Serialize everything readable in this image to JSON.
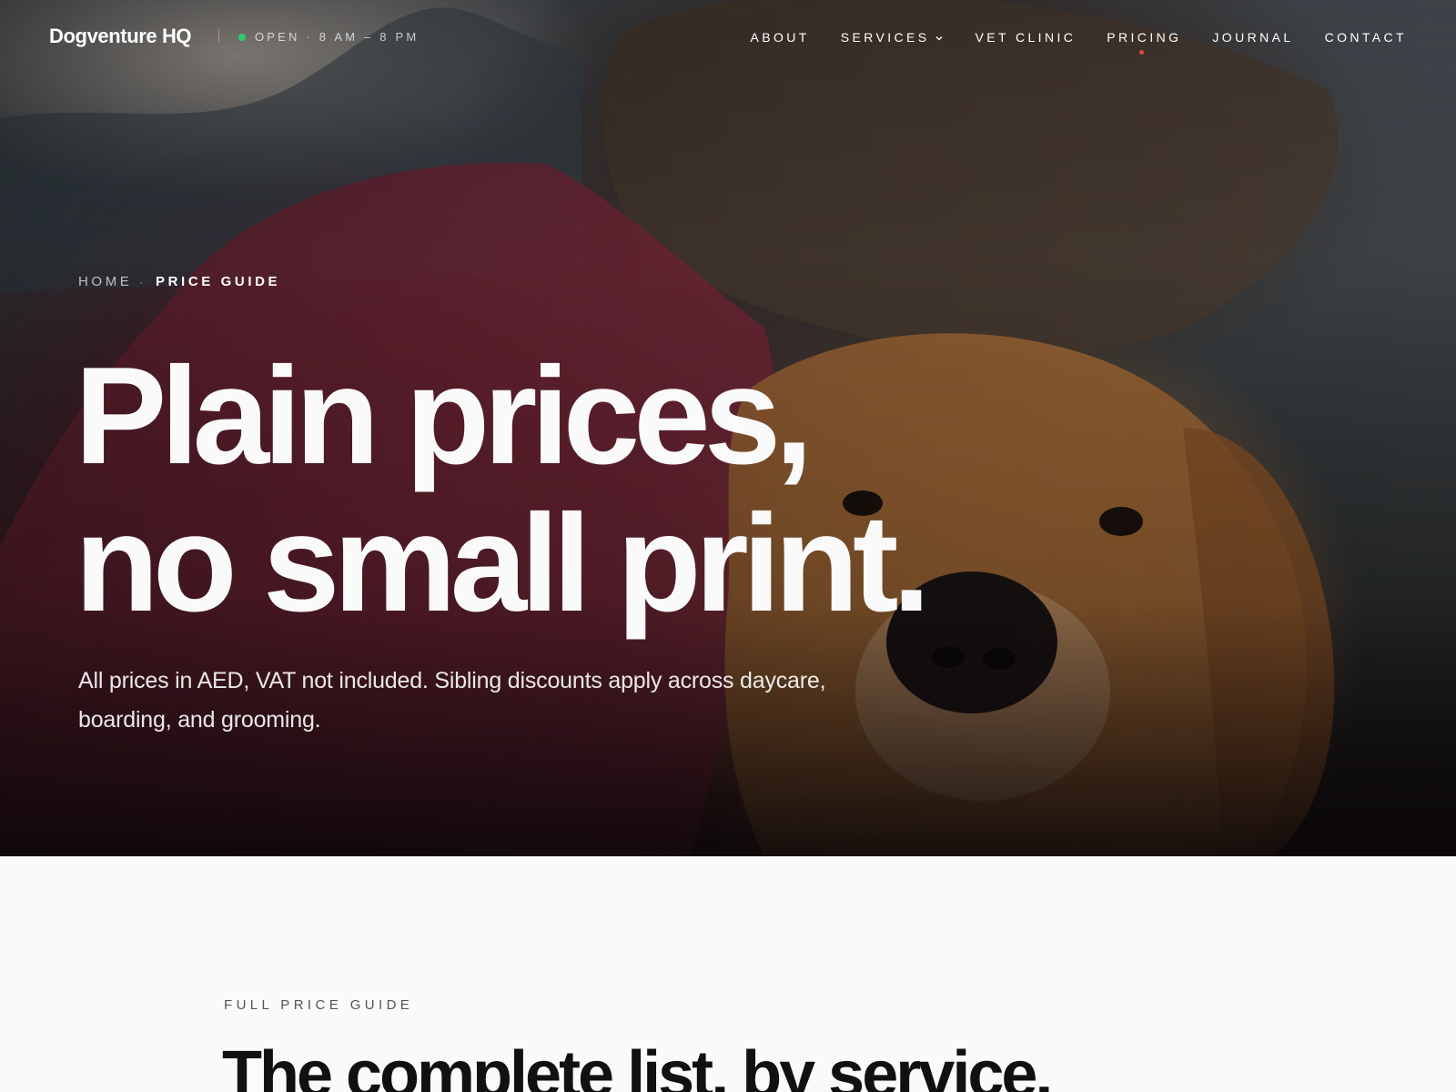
{
  "brand": {
    "name": "Dogventure HQ"
  },
  "status": {
    "text": "OPEN · 8 AM – 8 PM",
    "color": "#2ecc71"
  },
  "nav": {
    "items": [
      {
        "label": "ABOUT"
      },
      {
        "label": "SERVICES",
        "has_dropdown": true
      },
      {
        "label": "VET CLINIC"
      },
      {
        "label": "PRICING",
        "active": true
      },
      {
        "label": "JOURNAL"
      },
      {
        "label": "CONTACT"
      }
    ],
    "active_indicator_color": "#e04848"
  },
  "breadcrumb": {
    "home": "HOME",
    "separator": "·",
    "current": "PRICE GUIDE"
  },
  "hero": {
    "title_line_1": "Plain prices,",
    "title_line_2": "no small print.",
    "subtitle_line_1": "All prices in AED, VAT not included. Sibling discounts apply across daycare,",
    "subtitle_line_2": "boarding, and grooming."
  },
  "section": {
    "eyebrow": "FULL PRICE GUIDE",
    "title": "The complete list, by service."
  }
}
